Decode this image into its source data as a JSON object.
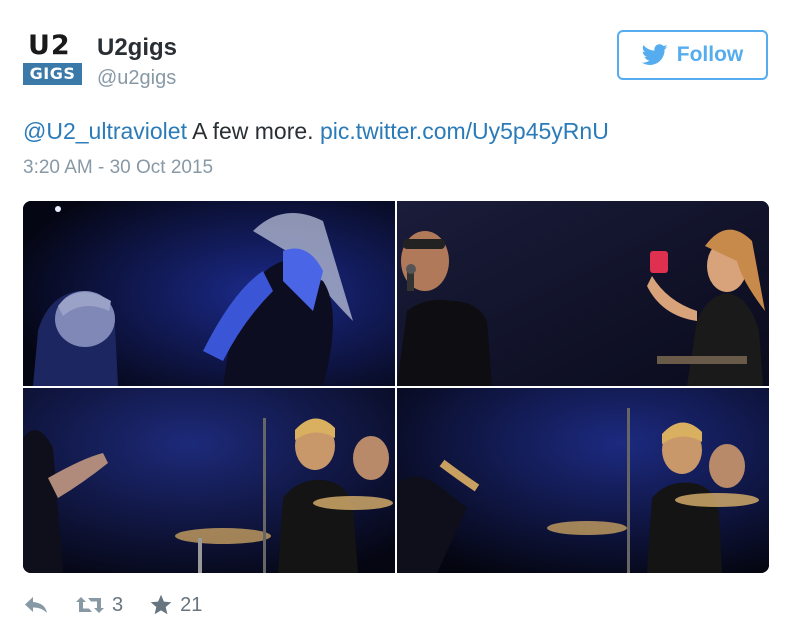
{
  "user": {
    "avatar_top": "U2",
    "avatar_bottom": "GIGS",
    "display_name": "U2gigs",
    "handle": "@u2gigs"
  },
  "follow": {
    "label": "Follow",
    "icon": "twitter-bird-icon",
    "color": "#55acee"
  },
  "tweet": {
    "mention": "@U2_ultraviolet",
    "text": " A few more. ",
    "link": "pic.twitter.com/Uy5p45yRnU",
    "timestamp": "3:20 AM - 30 Oct 2015"
  },
  "media": {
    "photos": [
      {
        "name": "photo-1"
      },
      {
        "name": "photo-2"
      },
      {
        "name": "photo-3"
      },
      {
        "name": "photo-4"
      }
    ]
  },
  "actions": {
    "reply_icon": "reply-icon",
    "retweet_icon": "retweet-icon",
    "retweet_count": "3",
    "favorite_icon": "star-icon",
    "favorite_count": "21"
  },
  "colors": {
    "link": "#2b7bb9",
    "muted": "#8899a6",
    "avatar_badge": "#3b79a8"
  }
}
